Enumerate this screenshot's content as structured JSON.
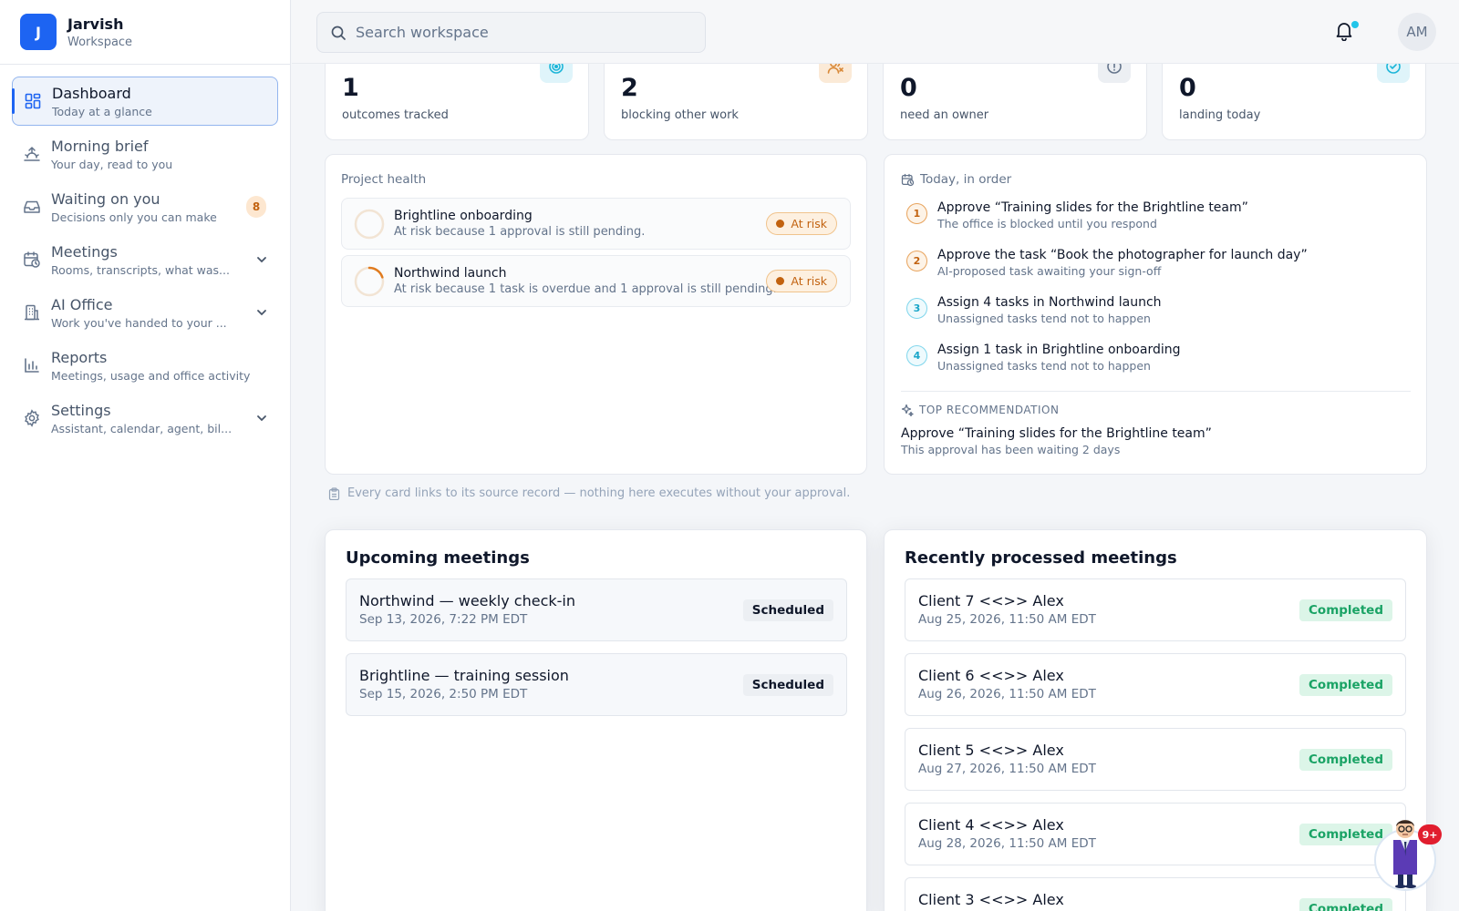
{
  "brand": {
    "initial": "J",
    "name": "Jarvish",
    "subtitle": "Workspace"
  },
  "nav": [
    {
      "label": "Dashboard",
      "desc": "Today at a glance",
      "icon": "dashboard-grid-icon",
      "active": true
    },
    {
      "label": "Morning brief",
      "desc": "Your day, read to you",
      "icon": "sunrise-icon"
    },
    {
      "label": "Waiting on you",
      "desc": "Decisions only you can make",
      "icon": "inbox-icon",
      "badge": "8"
    },
    {
      "label": "Meetings",
      "desc": "Rooms, transcripts, what was...",
      "icon": "calendar-clock-icon",
      "expandable": true
    },
    {
      "label": "AI Office",
      "desc": "Work you've handed to your ...",
      "icon": "building-icon",
      "expandable": true
    },
    {
      "label": "Reports",
      "desc": "Meetings, usage and office activity",
      "icon": "bar-chart-icon"
    },
    {
      "label": "Settings",
      "desc": "Assistant, calendar, agent, bil...",
      "icon": "gear-icon",
      "expandable": true
    }
  ],
  "search": {
    "placeholder": "Search workspace",
    "value": ""
  },
  "user": {
    "initials": "AM"
  },
  "kpis": [
    {
      "value": "1",
      "label": "outcomes tracked",
      "icon": "target-icon",
      "accent": "#1cb5d8"
    },
    {
      "value": "2",
      "label": "blocking other work",
      "icon": "users-icon",
      "accent": "#d98a3a"
    },
    {
      "value": "0",
      "label": "need an owner",
      "icon": "alert-circle-icon",
      "accent": "#64748b"
    },
    {
      "value": "0",
      "label": "landing today",
      "icon": "check-clock-icon",
      "accent": "#1cb5d8"
    }
  ],
  "project_health": {
    "title": "Project health",
    "projects": [
      {
        "name": "Brightline onboarding",
        "desc": "At risk because 1 approval is still pending.",
        "status": "At risk",
        "progress": 0
      },
      {
        "name": "Northwind launch",
        "desc": "At risk because 1 task is overdue and 1 approval is still pending.",
        "status": "At risk",
        "progress": 0.2
      }
    ]
  },
  "today": {
    "title": "Today, in order",
    "items": [
      {
        "num": "1",
        "title": "Approve “Training slides for the Brightline team”",
        "sub": "The office is blocked until you respond"
      },
      {
        "num": "2",
        "title": "Approve the task “Book the photographer for launch day”",
        "sub": "AI-proposed task awaiting your sign-off"
      },
      {
        "num": "3",
        "title": "Assign 4 tasks in Northwind launch",
        "sub": "Unassigned tasks tend not to happen"
      },
      {
        "num": "4",
        "title": "Assign 1 task in Brightline onboarding",
        "sub": "Unassigned tasks tend not to happen"
      }
    ],
    "recommendation_label": "TOP RECOMMENDATION",
    "recommendation_title": "Approve “Training slides for the Brightline team”",
    "recommendation_sub": "This approval has been waiting 2 days"
  },
  "footnote": "Every card links to its source record — nothing here executes without your approval.",
  "upcoming": {
    "title": "Upcoming meetings",
    "meetings": [
      {
        "title": "Northwind — weekly check-in",
        "date": "Sep 13, 2026, 7:22 PM EDT",
        "status": "Scheduled"
      },
      {
        "title": "Brightline — training session",
        "date": "Sep 15, 2026, 2:50 PM EDT",
        "status": "Scheduled"
      }
    ]
  },
  "processed": {
    "title": "Recently processed meetings",
    "meetings": [
      {
        "title": "Client 7 <<>> Alex",
        "date": "Aug 25, 2026, 11:50 AM EDT",
        "status": "Completed"
      },
      {
        "title": "Client 6 <<>> Alex",
        "date": "Aug 26, 2026, 11:50 AM EDT",
        "status": "Completed"
      },
      {
        "title": "Client 5 <<>> Alex",
        "date": "Aug 27, 2026, 11:50 AM EDT",
        "status": "Completed"
      },
      {
        "title": "Client 4 <<>> Alex",
        "date": "Aug 28, 2026, 11:50 AM EDT",
        "status": "Completed"
      },
      {
        "title": "Client 3 <<>> Alex",
        "date": "",
        "status": "Completed"
      }
    ]
  },
  "assistant": {
    "badge": "9+"
  }
}
